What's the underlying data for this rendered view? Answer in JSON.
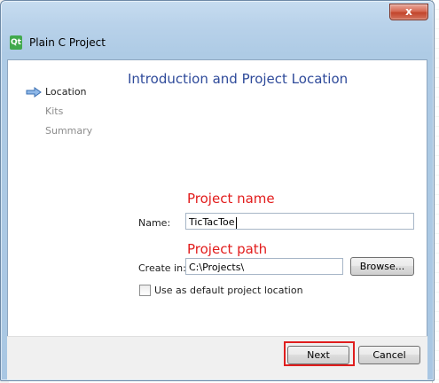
{
  "window": {
    "close_glyph": "x"
  },
  "app": {
    "icon_text": "Qt",
    "title": "Plain C Project"
  },
  "wizard": {
    "steps": [
      {
        "label": "Location",
        "active": true
      },
      {
        "label": "Kits",
        "active": false
      },
      {
        "label": "Summary",
        "active": false
      }
    ],
    "page_title": "Introduction and Project Location",
    "annotations": {
      "project_name": "Project name",
      "project_path": "Project path"
    },
    "name_label": "Name:",
    "name_value": "TicTacToe",
    "create_in_label": "Create in:",
    "create_in_value": "C:\\Projects\\",
    "browse_label": "Browse...",
    "default_location_label": "Use as default project location",
    "default_location_checked": false
  },
  "footer": {
    "next_label": "Next",
    "cancel_label": "Cancel"
  },
  "colors": {
    "accent_title": "#2e4a9a",
    "annotation_red": "#e21c1c",
    "close_red": "#c2452c"
  }
}
